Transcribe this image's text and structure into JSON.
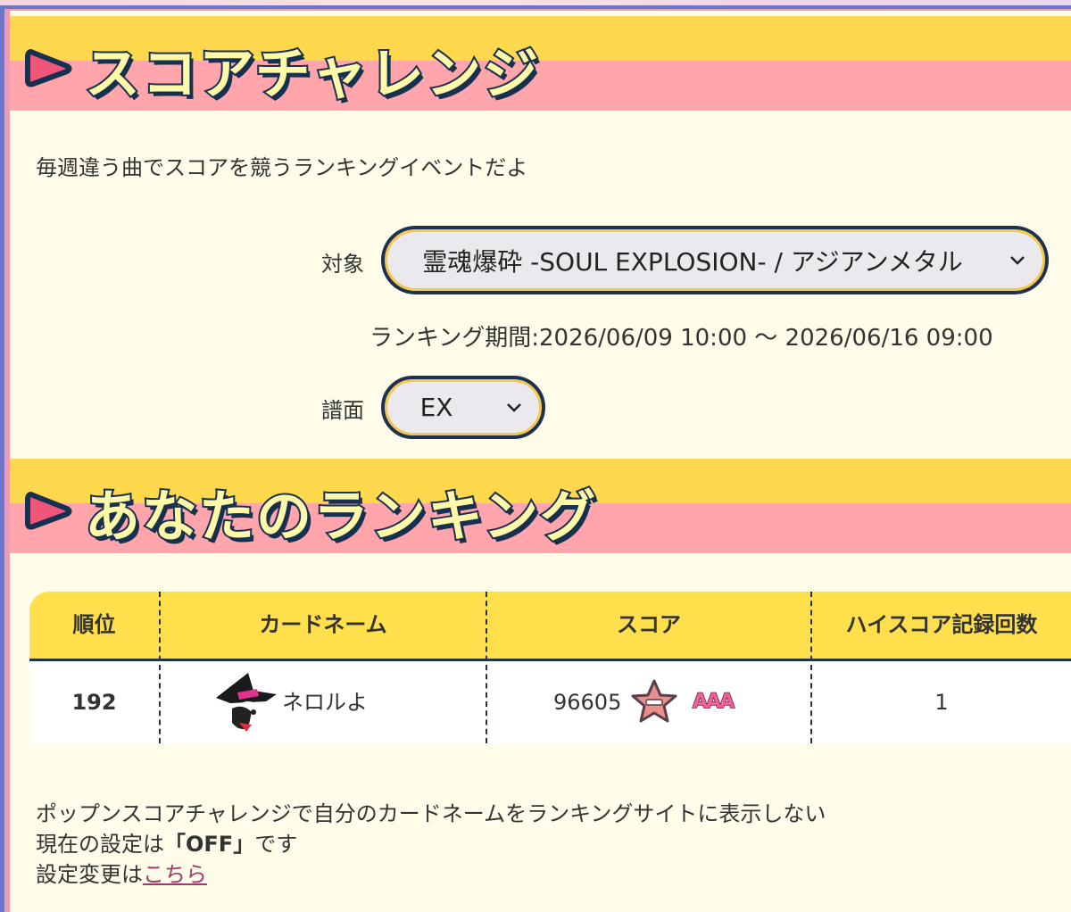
{
  "sections": {
    "score_challenge_title": "スコアチャレンジ",
    "your_ranking_title": "あなたのランキング"
  },
  "description": "毎週違う曲でスコアを競うランキングイベントだよ",
  "target": {
    "label": "対象",
    "selected": "霊魂爆砕 -SOUL EXPLOSION- / アジアンメタル"
  },
  "period": {
    "text": "ランキング期間:2026/06/09 10:00 ～ 2026/06/16 09:00"
  },
  "chart": {
    "label": "譜面",
    "selected": "EX"
  },
  "ranking_table": {
    "headers": [
      "順位",
      "カードネーム",
      "スコア",
      "ハイスコア記録回数"
    ],
    "row": {
      "rank": "192",
      "card_name": "ネロルよ",
      "score": "96605",
      "medal_icon": "star-medal-icon",
      "grade_badge": "AAA",
      "highscore_count": "1"
    }
  },
  "footer": {
    "line1": "ポップンスコアチャレンジで自分のカードネームをランキングサイトに表示しない",
    "line2_prefix": "現在の設定は",
    "line2_value": "「OFF」",
    "line2_suffix": "です",
    "line3_prefix": "設定変更は",
    "line3_link": "こちら"
  },
  "colors": {
    "header_yellow": "#ffd84e",
    "header_pink": "#ffa5ab",
    "background": "#fffde9",
    "navy": "#1f3150",
    "link": "#a0396b"
  }
}
